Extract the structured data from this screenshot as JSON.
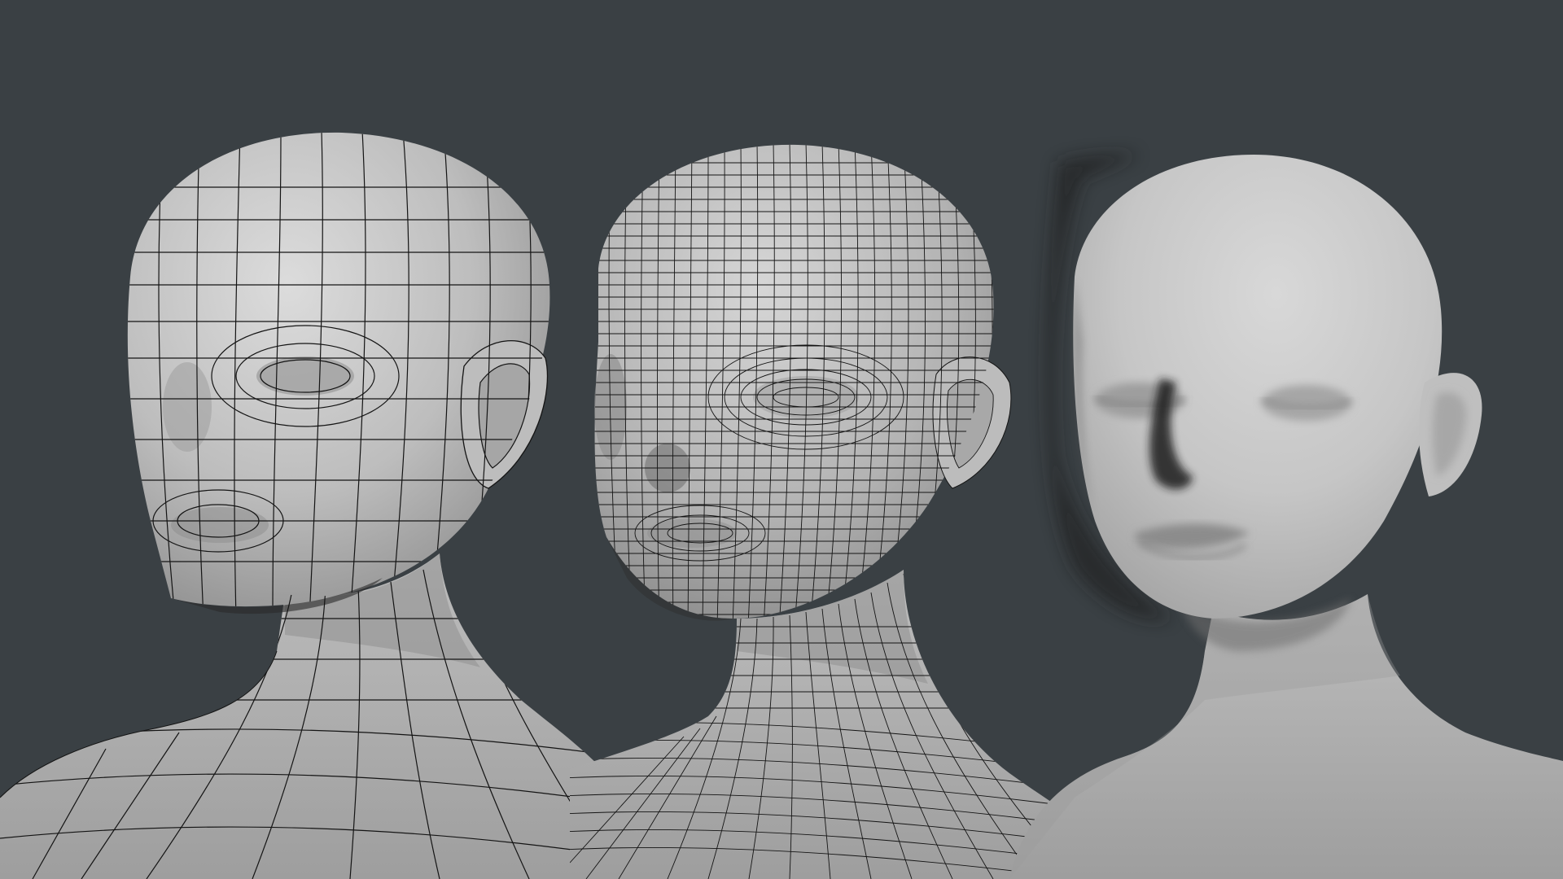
{
  "scene": {
    "subjects": [
      {
        "name": "low-poly-wireframe-head",
        "mesh_density": "low",
        "wireframe": true
      },
      {
        "name": "high-poly-wireframe-head",
        "mesh_density": "high",
        "wireframe": true
      },
      {
        "name": "smooth-shaded-head",
        "mesh_density": "subdivided",
        "wireframe": false
      }
    ]
  },
  "colors": {
    "background": "#3a4044",
    "clay_light": "#d2d2d2",
    "clay_mid": "#b4b4b4",
    "clay_shadow": "#6e6e6e",
    "wire": "#141414"
  }
}
